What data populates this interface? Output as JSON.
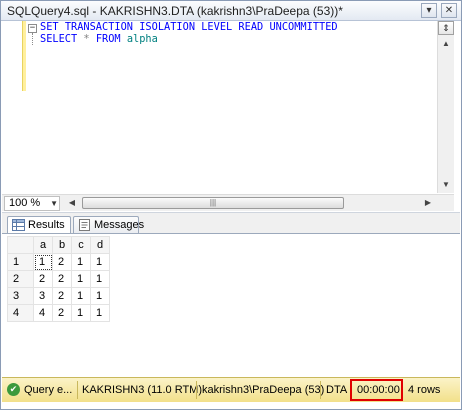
{
  "window": {
    "title": "SQLQuery4.sql - KAKRISHN3.DTA (kakrishn3\\PraDeepa (53))*",
    "pin_icon": "pin-icon",
    "close_icon": "close-icon"
  },
  "editor": {
    "lines": [
      [
        {
          "text": "SET",
          "type": "keyword"
        },
        {
          "text": " ",
          "type": "plain"
        },
        {
          "text": "TRANSACTION",
          "type": "keyword"
        },
        {
          "text": " ",
          "type": "plain"
        },
        {
          "text": "ISOLATION",
          "type": "keyword"
        },
        {
          "text": " ",
          "type": "plain"
        },
        {
          "text": "LEVEL",
          "type": "keyword"
        },
        {
          "text": " ",
          "type": "plain"
        },
        {
          "text": "READ",
          "type": "keyword"
        },
        {
          "text": " ",
          "type": "plain"
        },
        {
          "text": "UNCOMMITTED",
          "type": "keyword"
        }
      ],
      [
        {
          "text": "SELECT",
          "type": "keyword"
        },
        {
          "text": " ",
          "type": "plain"
        },
        {
          "text": "*",
          "type": "operator"
        },
        {
          "text": " ",
          "type": "plain"
        },
        {
          "text": "FROM",
          "type": "keyword"
        },
        {
          "text": " ",
          "type": "plain"
        },
        {
          "text": "alpha",
          "type": "identifier"
        }
      ]
    ],
    "collapse_glyph": "−",
    "zoom": "100 %",
    "hscroll_thumb_glyph": "|||"
  },
  "tabs": [
    {
      "label": "Results",
      "icon": "grid-icon",
      "active": true
    },
    {
      "label": "Messages",
      "icon": "messages-icon",
      "active": false
    }
  ],
  "grid": {
    "columns": [
      "a",
      "b",
      "c",
      "d"
    ],
    "rows": [
      {
        "num": "1",
        "cells": [
          "1",
          "2",
          "1",
          "1"
        ]
      },
      {
        "num": "2",
        "cells": [
          "2",
          "2",
          "1",
          "1"
        ]
      },
      {
        "num": "3",
        "cells": [
          "3",
          "2",
          "1",
          "1"
        ]
      },
      {
        "num": "4",
        "cells": [
          "4",
          "2",
          "1",
          "1"
        ]
      }
    ]
  },
  "status": {
    "query_state": "Query e...",
    "server": "KAKRISHN3 (11.0 RTM)",
    "user": "kakrishn3\\PraDeepa (53)",
    "database": "DTA",
    "elapsed": "00:00:00",
    "rows": "4 rows",
    "ok_icon": "check-circle-icon",
    "highlight_color": "#e00000"
  },
  "colors": {
    "keyword": "#0000ff",
    "operator": "#808080",
    "identifier": "#008080",
    "status_bar": "#f5e9a8"
  }
}
